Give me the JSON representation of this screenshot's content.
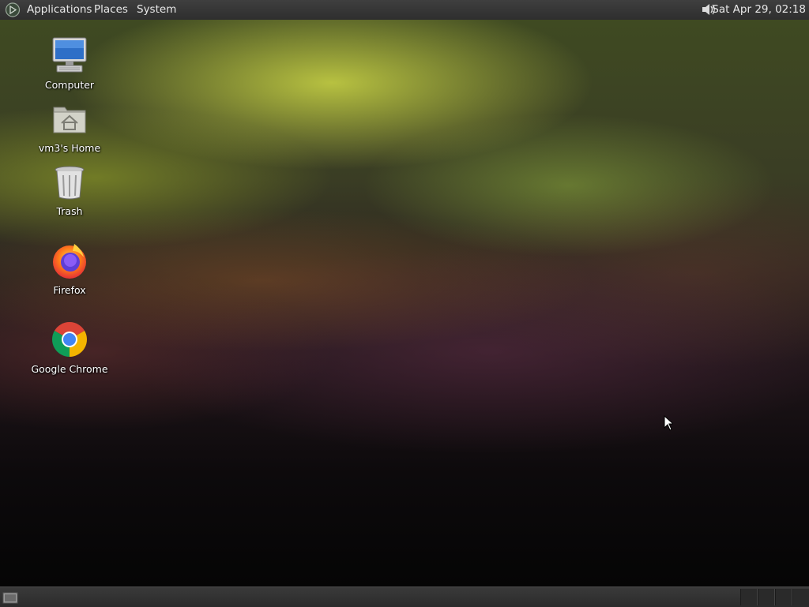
{
  "top_panel": {
    "menus": [
      {
        "label": "Applications"
      },
      {
        "label": "Places"
      },
      {
        "label": "System"
      }
    ],
    "clock": "Sat Apr 29, 02:18",
    "icons": {
      "logo": "gnome-foot-logo-icon",
      "sound": "speaker-volume-icon"
    }
  },
  "desktop": {
    "icons": [
      {
        "label": "Computer",
        "icon": "computer-monitor-icon"
      },
      {
        "label": "vm3's Home",
        "icon": "home-folder-icon"
      },
      {
        "label": "Trash",
        "icon": "trash-can-icon"
      },
      {
        "label": "Firefox",
        "icon": "firefox-icon"
      },
      {
        "label": "Google Chrome",
        "icon": "chrome-icon"
      }
    ]
  },
  "bottom_panel": {
    "icons": {
      "show_desktop": "show-desktop-icon"
    },
    "workspace_count": 4
  },
  "colors": {
    "panel": "#2e2e2e",
    "panel_text": "#e8e8e8",
    "desktop_text": "#ffffff"
  }
}
